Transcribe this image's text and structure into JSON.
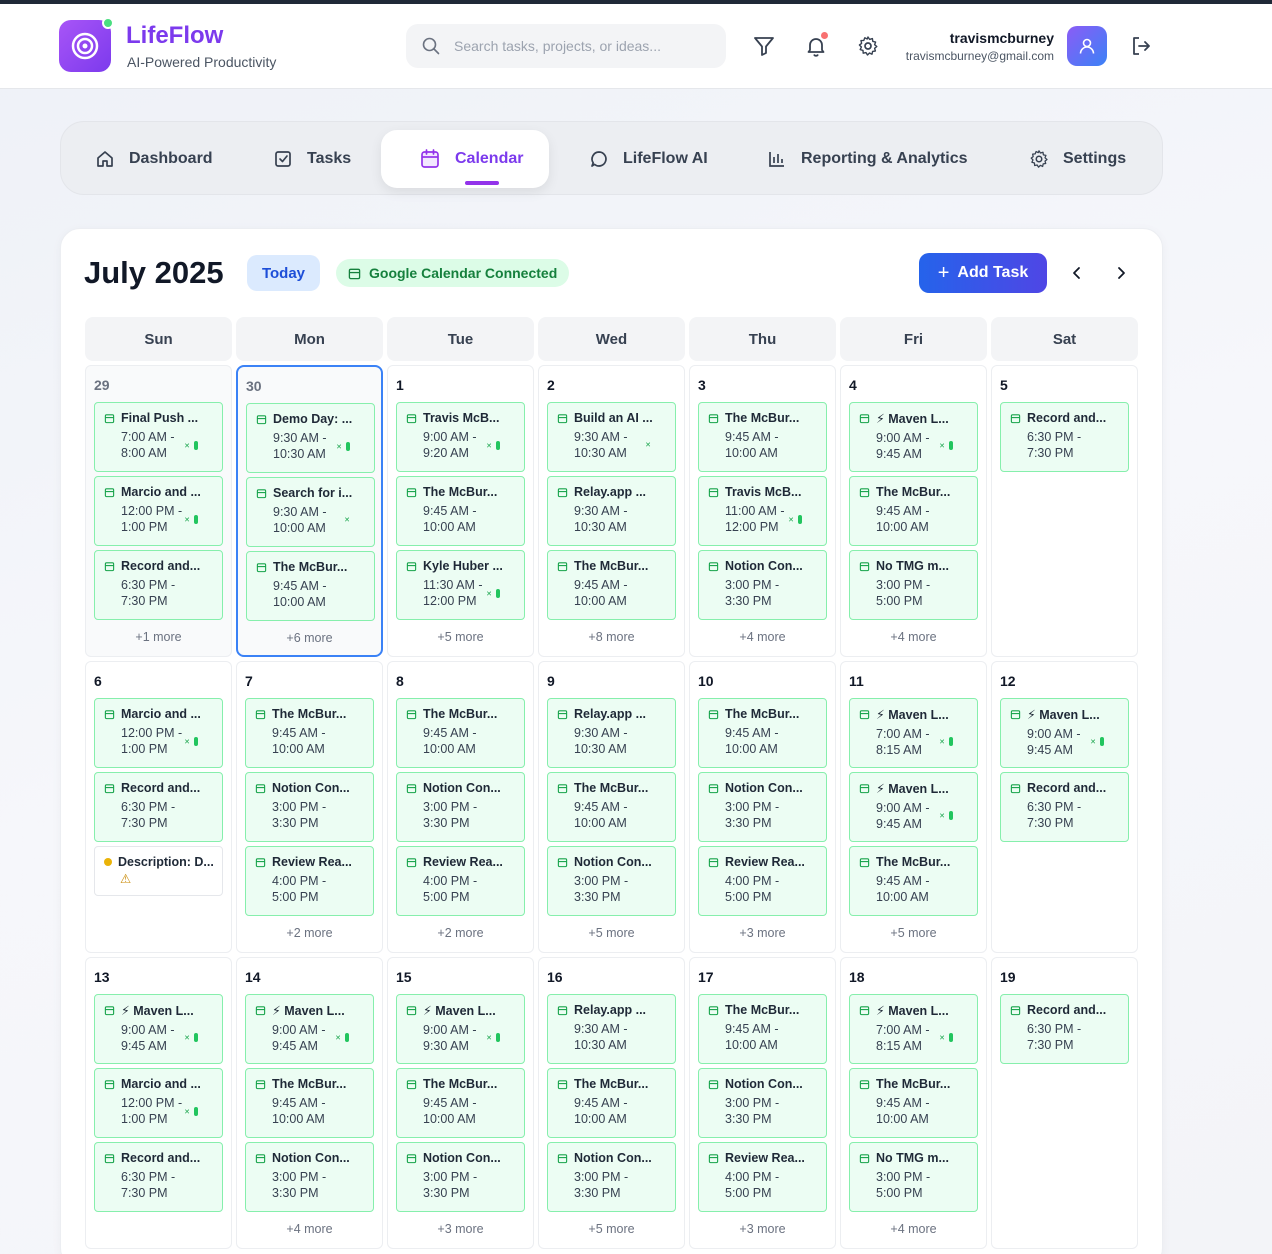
{
  "header": {
    "brand_title": "LifeFlow",
    "brand_subtitle": "AI-Powered Productivity",
    "search_placeholder": "Search tasks, projects, or ideas...",
    "user_name": "travismcburney",
    "user_email": "travismcburney@gmail.com"
  },
  "nav": {
    "tabs": [
      {
        "label": "Dashboard",
        "icon": "home-icon"
      },
      {
        "label": "Tasks",
        "icon": "checkbox-icon"
      },
      {
        "label": "Calendar",
        "icon": "calendar-icon",
        "active": true
      },
      {
        "label": "LifeFlow AI",
        "icon": "chat-bubble-icon"
      },
      {
        "label": "Reporting & Analytics",
        "icon": "bar-chart-icon"
      },
      {
        "label": "Settings",
        "icon": "gear-icon"
      }
    ]
  },
  "calendar": {
    "month_label": "July 2025",
    "today_label": "Today",
    "google_status": "Google Calendar Connected",
    "add_task_label": "Add Task",
    "weekdays": [
      "Sun",
      "Mon",
      "Tue",
      "Wed",
      "Thu",
      "Fri",
      "Sat"
    ],
    "colors": {
      "accent": "#7c3aed",
      "event_bg": "#ecfdf3",
      "event_border": "#86efac",
      "selected": "#3b82f6"
    },
    "weeks": [
      [
        {
          "day": "29",
          "other": true,
          "events": [
            {
              "title": "Final Push ...",
              "time": "7:00 AM - 8:00 AM",
              "sync": true
            },
            {
              "title": "Marcio and ...",
              "time": "12:00 PM - 1:00 PM",
              "sync": true
            },
            {
              "title": "Record and...",
              "time": "6:30 PM - 7:30 PM"
            }
          ],
          "more": "+1 more"
        },
        {
          "day": "30",
          "other": true,
          "selected": true,
          "events": [
            {
              "title": "Demo Day: ...",
              "time": "9:30 AM - 10:30 AM",
              "sync": true
            },
            {
              "title": "Search for i...",
              "time": "9:30 AM - 10:00 AM",
              "synclite": true
            },
            {
              "title": "The McBur...",
              "time": "9:45 AM - 10:00 AM"
            }
          ],
          "more": "+6 more"
        },
        {
          "day": "1",
          "events": [
            {
              "title": "Travis McB...",
              "time": "9:00 AM - 9:20 AM",
              "sync": true
            },
            {
              "title": "The McBur...",
              "time": "9:45 AM - 10:00 AM"
            },
            {
              "title": "Kyle Huber ...",
              "time": "11:30 AM - 12:00 PM",
              "sync": true
            }
          ],
          "more": "+5 more"
        },
        {
          "day": "2",
          "events": [
            {
              "title": "Build an AI ...",
              "time": "9:30 AM - 10:30 AM",
              "synclite": true
            },
            {
              "title": "Relay.app ...",
              "time": "9:30 AM - 10:30 AM"
            },
            {
              "title": "The McBur...",
              "time": "9:45 AM - 10:00 AM"
            }
          ],
          "more": "+8 more"
        },
        {
          "day": "3",
          "events": [
            {
              "title": "The McBur...",
              "time": "9:45 AM - 10:00 AM"
            },
            {
              "title": "Travis McB...",
              "time": "11:00 AM - 12:00 PM",
              "sync": true
            },
            {
              "title": "Notion Con...",
              "time": "3:00 PM - 3:30 PM"
            }
          ],
          "more": "+4 more"
        },
        {
          "day": "4",
          "events": [
            {
              "title": "⚡ Maven L...",
              "time": "9:00 AM - 9:45 AM",
              "sync": true
            },
            {
              "title": "The McBur...",
              "time": "9:45 AM - 10:00 AM"
            },
            {
              "title": "No TMG m...",
              "time": "3:00 PM - 5:00 PM"
            }
          ],
          "more": "+4 more"
        },
        {
          "day": "5",
          "events": [
            {
              "title": "Record and...",
              "time": "6:30 PM - 7:30 PM"
            }
          ],
          "more": ""
        }
      ],
      [
        {
          "day": "6",
          "events": [
            {
              "title": "Marcio and ...",
              "time": "12:00 PM - 1:00 PM",
              "sync": true
            },
            {
              "title": "Record and...",
              "time": "6:30 PM - 7:30 PM"
            },
            {
              "title": "Description: D...",
              "time": "⚠",
              "plain": true
            }
          ],
          "more": ""
        },
        {
          "day": "7",
          "events": [
            {
              "title": "The McBur...",
              "time": "9:45 AM - 10:00 AM"
            },
            {
              "title": "Notion Con...",
              "time": "3:00 PM - 3:30 PM"
            },
            {
              "title": "Review Rea...",
              "time": "4:00 PM - 5:00 PM"
            }
          ],
          "more": "+2 more"
        },
        {
          "day": "8",
          "events": [
            {
              "title": "The McBur...",
              "time": "9:45 AM - 10:00 AM"
            },
            {
              "title": "Notion Con...",
              "time": "3:00 PM - 3:30 PM"
            },
            {
              "title": "Review Rea...",
              "time": "4:00 PM - 5:00 PM"
            }
          ],
          "more": "+2 more"
        },
        {
          "day": "9",
          "events": [
            {
              "title": "Relay.app ...",
              "time": "9:30 AM - 10:30 AM"
            },
            {
              "title": "The McBur...",
              "time": "9:45 AM - 10:00 AM"
            },
            {
              "title": "Notion Con...",
              "time": "3:00 PM - 3:30 PM"
            }
          ],
          "more": "+5 more"
        },
        {
          "day": "10",
          "events": [
            {
              "title": "The McBur...",
              "time": "9:45 AM - 10:00 AM"
            },
            {
              "title": "Notion Con...",
              "time": "3:00 PM - 3:30 PM"
            },
            {
              "title": "Review Rea...",
              "time": "4:00 PM - 5:00 PM"
            }
          ],
          "more": "+3 more"
        },
        {
          "day": "11",
          "events": [
            {
              "title": "⚡ Maven L...",
              "time": "7:00 AM - 8:15 AM",
              "sync": true
            },
            {
              "title": "⚡ Maven L...",
              "time": "9:00 AM - 9:45 AM",
              "sync": true
            },
            {
              "title": "The McBur...",
              "time": "9:45 AM - 10:00 AM"
            }
          ],
          "more": "+5 more"
        },
        {
          "day": "12",
          "events": [
            {
              "title": "⚡ Maven L...",
              "time": "9:00 AM - 9:45 AM",
              "sync": true
            },
            {
              "title": "Record and...",
              "time": "6:30 PM - 7:30 PM"
            }
          ],
          "more": ""
        }
      ],
      [
        {
          "day": "13",
          "events": [
            {
              "title": "⚡ Maven L...",
              "time": "9:00 AM - 9:45 AM",
              "sync": true
            },
            {
              "title": "Marcio and ...",
              "time": "12:00 PM - 1:00 PM",
              "sync": true
            },
            {
              "title": "Record and...",
              "time": "6:30 PM - 7:30 PM"
            }
          ],
          "more": ""
        },
        {
          "day": "14",
          "events": [
            {
              "title": "⚡ Maven L...",
              "time": "9:00 AM - 9:45 AM",
              "sync": true
            },
            {
              "title": "The McBur...",
              "time": "9:45 AM - 10:00 AM"
            },
            {
              "title": "Notion Con...",
              "time": "3:00 PM - 3:30 PM"
            }
          ],
          "more": "+4 more"
        },
        {
          "day": "15",
          "events": [
            {
              "title": "⚡ Maven L...",
              "time": "9:00 AM - 9:30 AM",
              "sync": true
            },
            {
              "title": "The McBur...",
              "time": "9:45 AM - 10:00 AM"
            },
            {
              "title": "Notion Con...",
              "time": "3:00 PM - 3:30 PM"
            }
          ],
          "more": "+3 more"
        },
        {
          "day": "16",
          "events": [
            {
              "title": "Relay.app ...",
              "time": "9:30 AM - 10:30 AM"
            },
            {
              "title": "The McBur...",
              "time": "9:45 AM - 10:00 AM"
            },
            {
              "title": "Notion Con...",
              "time": "3:00 PM - 3:30 PM"
            }
          ],
          "more": "+5 more"
        },
        {
          "day": "17",
          "events": [
            {
              "title": "The McBur...",
              "time": "9:45 AM - 10:00 AM"
            },
            {
              "title": "Notion Con...",
              "time": "3:00 PM - 3:30 PM"
            },
            {
              "title": "Review Rea...",
              "time": "4:00 PM - 5:00 PM"
            }
          ],
          "more": "+3 more"
        },
        {
          "day": "18",
          "events": [
            {
              "title": "⚡ Maven L...",
              "time": "7:00 AM - 8:15 AM",
              "sync": true
            },
            {
              "title": "The McBur...",
              "time": "9:45 AM - 10:00 AM"
            },
            {
              "title": "No TMG m...",
              "time": "3:00 PM - 5:00 PM"
            }
          ],
          "more": "+4 more"
        },
        {
          "day": "19",
          "events": [
            {
              "title": "Record and...",
              "time": "6:30 PM - 7:30 PM"
            }
          ],
          "more": ""
        }
      ]
    ]
  }
}
